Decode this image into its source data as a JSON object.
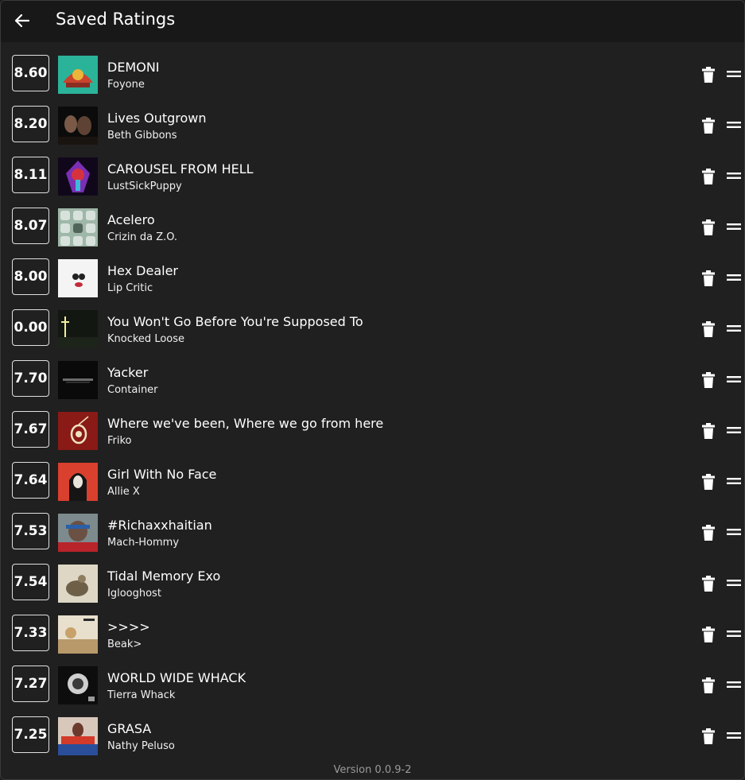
{
  "header": {
    "title": "Saved Ratings",
    "back_icon": "arrow-left-icon"
  },
  "ratings": [
    {
      "score": "8.60",
      "title": "DEMONI",
      "artist": "Foyone"
    },
    {
      "score": "8.20",
      "title": "Lives Outgrown",
      "artist": "Beth Gibbons"
    },
    {
      "score": "8.11",
      "title": "CAROUSEL FROM HELL",
      "artist": "LustSickPuppy"
    },
    {
      "score": "8.07",
      "title": "Acelero",
      "artist": "Crizin da Z.O."
    },
    {
      "score": "8.00",
      "title": "Hex Dealer",
      "artist": "Lip Critic"
    },
    {
      "score": "0.00",
      "title": "You Won't Go Before You're Supposed To",
      "artist": "Knocked Loose"
    },
    {
      "score": "7.70",
      "title": "Yacker",
      "artist": "Container"
    },
    {
      "score": "7.67",
      "title": "Where we've been, Where we go from here",
      "artist": "Friko"
    },
    {
      "score": "7.64",
      "title": "Girl With No Face",
      "artist": "Allie X"
    },
    {
      "score": "7.53",
      "title": "#Richaxxhaitian",
      "artist": "Mach-Hommy"
    },
    {
      "score": "7.54",
      "title": "Tidal Memory Exo",
      "artist": "Iglooghost"
    },
    {
      "score": "7.33",
      "title": ">>>>",
      "artist": "Beak>"
    },
    {
      "score": "7.27",
      "title": "WORLD WIDE WHACK",
      "artist": "Tierra Whack"
    },
    {
      "score": "7.25",
      "title": "GRASA",
      "artist": "Nathy Peluso"
    }
  ],
  "footer": {
    "version": "Version 0.0.9-2"
  },
  "colors": {
    "background": "#202020",
    "header": "#181818",
    "text": "#ffffff",
    "muted": "#9a9a9a"
  }
}
